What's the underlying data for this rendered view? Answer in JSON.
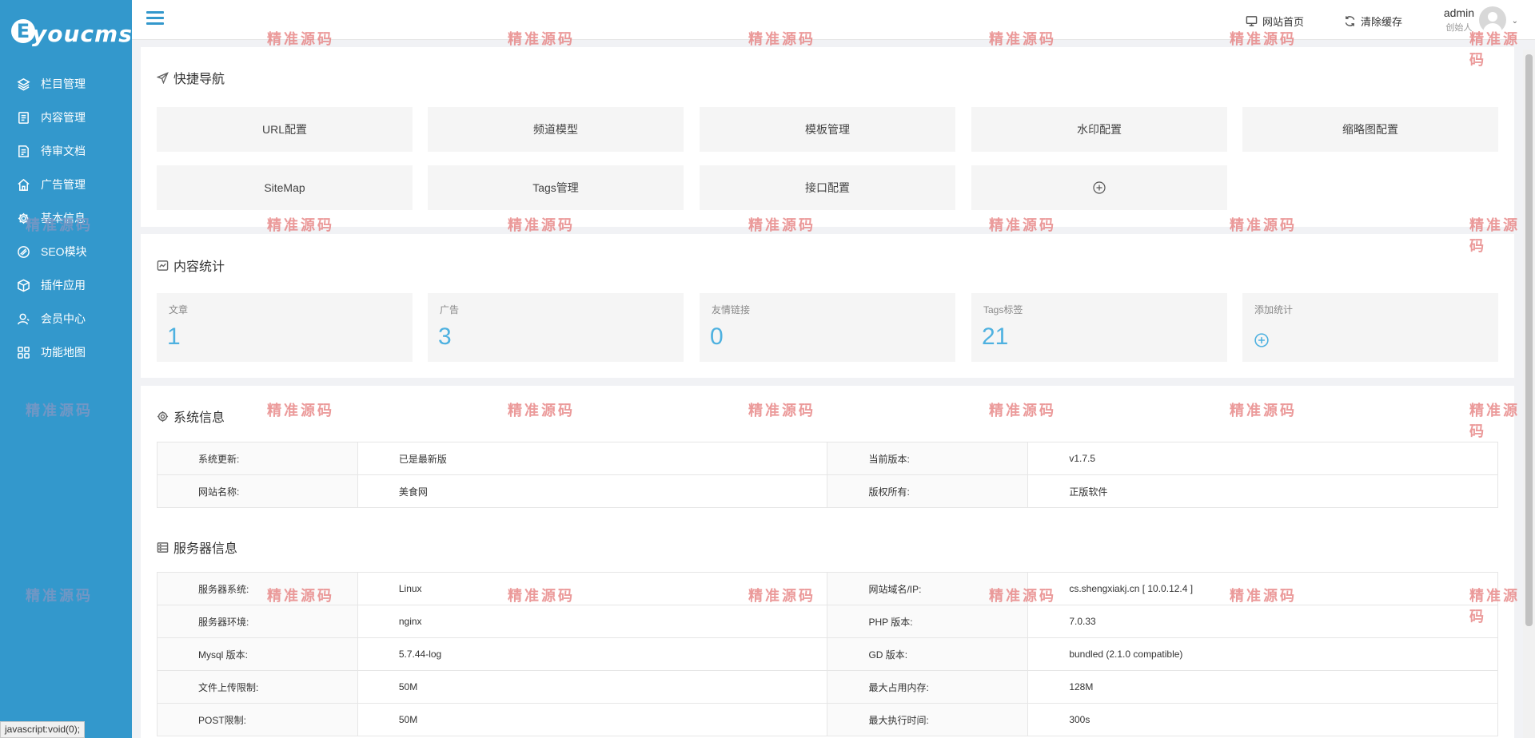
{
  "brand": {
    "logo_letter": "E",
    "logo_text": "youcms"
  },
  "sidebar": {
    "items": [
      {
        "label": "栏目管理",
        "icon": "layers-icon"
      },
      {
        "label": "内容管理",
        "icon": "document-icon"
      },
      {
        "label": "待审文档",
        "icon": "review-doc-icon"
      },
      {
        "label": "广告管理",
        "icon": "home-icon"
      },
      {
        "label": "基本信息",
        "icon": "gear-icon"
      },
      {
        "label": "SEO模块",
        "icon": "seo-icon"
      },
      {
        "label": "插件应用",
        "icon": "cube-icon"
      },
      {
        "label": "会员中心",
        "icon": "user-icon"
      },
      {
        "label": "功能地图",
        "icon": "grid-icon"
      }
    ]
  },
  "watermark": "精准源码",
  "topbar": {
    "home_link": "网站首页",
    "clear_cache": "清除缓存",
    "user_name": "admin",
    "user_role": "创始人"
  },
  "quick_nav": {
    "title": "快捷导航",
    "items": [
      "URL配置",
      "频道模型",
      "模板管理",
      "水印配置",
      "缩略图配置",
      "SiteMap",
      "Tags管理",
      "接口配置"
    ]
  },
  "content_stats": {
    "title": "内容统计",
    "items": [
      {
        "label": "文章",
        "value": "1"
      },
      {
        "label": "广告",
        "value": "3"
      },
      {
        "label": "友情链接",
        "value": "0"
      },
      {
        "label": "Tags标签",
        "value": "21"
      }
    ],
    "add_label": "添加统计"
  },
  "system_info": {
    "title": "系统信息",
    "rows": [
      [
        "系统更新:",
        "已是最新版",
        "当前版本:",
        "v1.7.5"
      ],
      [
        "网站名称:",
        "美食网",
        "版权所有:",
        "正版软件"
      ]
    ]
  },
  "server_info": {
    "title": "服务器信息",
    "rows": [
      [
        "服务器系统:",
        "Linux",
        "网站域名/IP:",
        "cs.shengxiakj.cn [ 10.0.12.4 ]"
      ],
      [
        "服务器环境:",
        "nginx",
        "PHP 版本:",
        "7.0.33"
      ],
      [
        "Mysql 版本:",
        "5.7.44-log",
        "GD 版本:",
        "bundled (2.1.0 compatible)"
      ],
      [
        "文件上传限制:",
        "50M",
        "最大占用内存:",
        "128M"
      ],
      [
        "POST限制:",
        "50M",
        "最大执行时间:",
        "300s"
      ]
    ]
  },
  "status_bar": "javascript:void(0);",
  "colors": {
    "sidebar": "#3398cc",
    "accent": "#4eb1e0"
  }
}
